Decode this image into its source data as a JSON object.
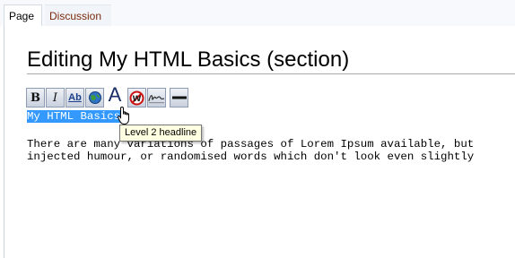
{
  "tabs": {
    "page": "Page",
    "discussion": "Discussion"
  },
  "heading": "Editing My HTML Basics (section)",
  "toolbar": {
    "bold": "B",
    "italic": "I",
    "link": "Ab",
    "headline": "A",
    "buttons": [
      "bold-icon",
      "italic-icon",
      "internal-link-icon",
      "external-link-globe-icon",
      "headline-icon",
      "nowiki-icon",
      "signature-icon",
      "horizontal-line-icon"
    ]
  },
  "editor": {
    "line1": "My HTML Basics",
    "line2": "There are many variations of passages of Lorem Ipsum available, but",
    "line3": "injected humour, or randomised words which don't look even slightly"
  },
  "tooltip": "Level 2 headline",
  "colors": {
    "selection": "#3399ff",
    "discussion_link": "#7a2a0c",
    "tooltip_bg": "#ffffe1"
  }
}
